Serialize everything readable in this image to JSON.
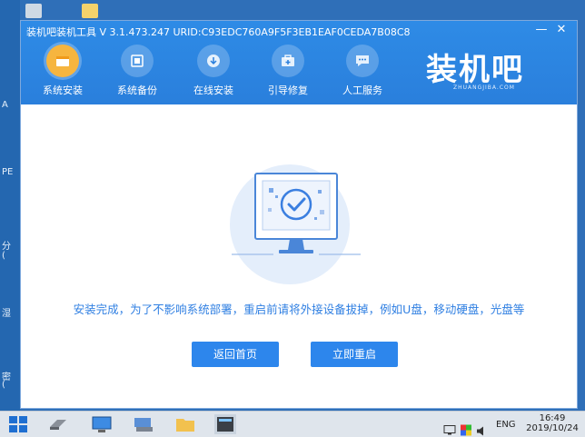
{
  "desktop": {
    "edge_letters": [
      "A",
      "PE",
      "分",
      "(",
      "湿",
      "密",
      "("
    ]
  },
  "window": {
    "title": "装机吧装机工具 V 3.1.473.247 URID:C93EDC760A9F5F3EB1EAF0CEDA7B08C8",
    "minimize_label": "—",
    "close_label": "✕"
  },
  "nav": {
    "items": [
      {
        "label": "系统安装",
        "icon": "system-install-icon",
        "active": true
      },
      {
        "label": "系统备份",
        "icon": "system-backup-icon",
        "active": false
      },
      {
        "label": "在线安装",
        "icon": "online-install-icon",
        "active": false
      },
      {
        "label": "引导修复",
        "icon": "boot-repair-icon",
        "active": false
      },
      {
        "label": "人工服务",
        "icon": "chat-service-icon",
        "active": false
      }
    ]
  },
  "logo": {
    "text": "装机吧",
    "subtitle": "ZHUANGJIBA.COM"
  },
  "main": {
    "message": "安装完成，为了不影响系统部署，重启前请将外接设备拔掉，例如U盘，移动硬盘，光盘等",
    "back_button": "返回首页",
    "restart_button": "立即重启"
  },
  "taskbar": {
    "language": "ENG",
    "time": "16:49",
    "date": "2019/10/24"
  },
  "colors": {
    "accent": "#2d86ec",
    "titlebar": "#2a7fdc",
    "active_tab": "#f6b53f"
  }
}
